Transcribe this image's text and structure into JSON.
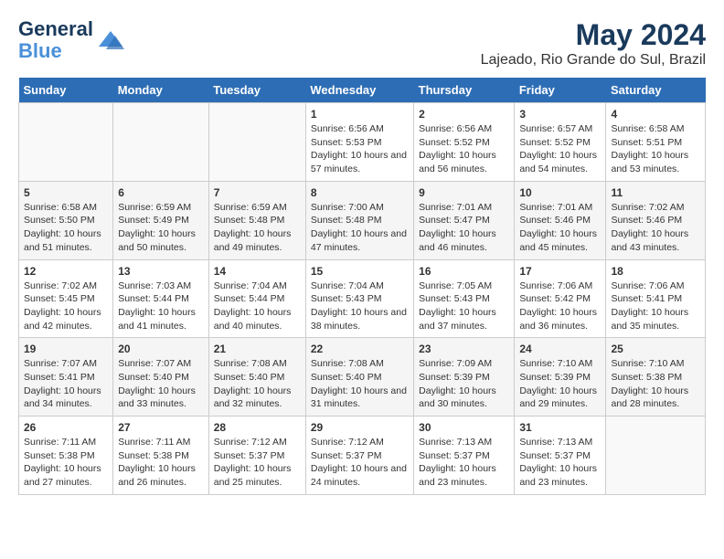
{
  "logo": {
    "line1": "General",
    "line2": "Blue"
  },
  "title": "May 2024",
  "subtitle": "Lajeado, Rio Grande do Sul, Brazil",
  "days_header": [
    "Sunday",
    "Monday",
    "Tuesday",
    "Wednesday",
    "Thursday",
    "Friday",
    "Saturday"
  ],
  "weeks": [
    [
      {
        "day": "",
        "sunrise": "",
        "sunset": "",
        "daylight": ""
      },
      {
        "day": "",
        "sunrise": "",
        "sunset": "",
        "daylight": ""
      },
      {
        "day": "",
        "sunrise": "",
        "sunset": "",
        "daylight": ""
      },
      {
        "day": "1",
        "sunrise": "Sunrise: 6:56 AM",
        "sunset": "Sunset: 5:53 PM",
        "daylight": "Daylight: 10 hours and 57 minutes."
      },
      {
        "day": "2",
        "sunrise": "Sunrise: 6:56 AM",
        "sunset": "Sunset: 5:52 PM",
        "daylight": "Daylight: 10 hours and 56 minutes."
      },
      {
        "day": "3",
        "sunrise": "Sunrise: 6:57 AM",
        "sunset": "Sunset: 5:52 PM",
        "daylight": "Daylight: 10 hours and 54 minutes."
      },
      {
        "day": "4",
        "sunrise": "Sunrise: 6:58 AM",
        "sunset": "Sunset: 5:51 PM",
        "daylight": "Daylight: 10 hours and 53 minutes."
      }
    ],
    [
      {
        "day": "5",
        "sunrise": "Sunrise: 6:58 AM",
        "sunset": "Sunset: 5:50 PM",
        "daylight": "Daylight: 10 hours and 51 minutes."
      },
      {
        "day": "6",
        "sunrise": "Sunrise: 6:59 AM",
        "sunset": "Sunset: 5:49 PM",
        "daylight": "Daylight: 10 hours and 50 minutes."
      },
      {
        "day": "7",
        "sunrise": "Sunrise: 6:59 AM",
        "sunset": "Sunset: 5:48 PM",
        "daylight": "Daylight: 10 hours and 49 minutes."
      },
      {
        "day": "8",
        "sunrise": "Sunrise: 7:00 AM",
        "sunset": "Sunset: 5:48 PM",
        "daylight": "Daylight: 10 hours and 47 minutes."
      },
      {
        "day": "9",
        "sunrise": "Sunrise: 7:01 AM",
        "sunset": "Sunset: 5:47 PM",
        "daylight": "Daylight: 10 hours and 46 minutes."
      },
      {
        "day": "10",
        "sunrise": "Sunrise: 7:01 AM",
        "sunset": "Sunset: 5:46 PM",
        "daylight": "Daylight: 10 hours and 45 minutes."
      },
      {
        "day": "11",
        "sunrise": "Sunrise: 7:02 AM",
        "sunset": "Sunset: 5:46 PM",
        "daylight": "Daylight: 10 hours and 43 minutes."
      }
    ],
    [
      {
        "day": "12",
        "sunrise": "Sunrise: 7:02 AM",
        "sunset": "Sunset: 5:45 PM",
        "daylight": "Daylight: 10 hours and 42 minutes."
      },
      {
        "day": "13",
        "sunrise": "Sunrise: 7:03 AM",
        "sunset": "Sunset: 5:44 PM",
        "daylight": "Daylight: 10 hours and 41 minutes."
      },
      {
        "day": "14",
        "sunrise": "Sunrise: 7:04 AM",
        "sunset": "Sunset: 5:44 PM",
        "daylight": "Daylight: 10 hours and 40 minutes."
      },
      {
        "day": "15",
        "sunrise": "Sunrise: 7:04 AM",
        "sunset": "Sunset: 5:43 PM",
        "daylight": "Daylight: 10 hours and 38 minutes."
      },
      {
        "day": "16",
        "sunrise": "Sunrise: 7:05 AM",
        "sunset": "Sunset: 5:43 PM",
        "daylight": "Daylight: 10 hours and 37 minutes."
      },
      {
        "day": "17",
        "sunrise": "Sunrise: 7:06 AM",
        "sunset": "Sunset: 5:42 PM",
        "daylight": "Daylight: 10 hours and 36 minutes."
      },
      {
        "day": "18",
        "sunrise": "Sunrise: 7:06 AM",
        "sunset": "Sunset: 5:41 PM",
        "daylight": "Daylight: 10 hours and 35 minutes."
      }
    ],
    [
      {
        "day": "19",
        "sunrise": "Sunrise: 7:07 AM",
        "sunset": "Sunset: 5:41 PM",
        "daylight": "Daylight: 10 hours and 34 minutes."
      },
      {
        "day": "20",
        "sunrise": "Sunrise: 7:07 AM",
        "sunset": "Sunset: 5:40 PM",
        "daylight": "Daylight: 10 hours and 33 minutes."
      },
      {
        "day": "21",
        "sunrise": "Sunrise: 7:08 AM",
        "sunset": "Sunset: 5:40 PM",
        "daylight": "Daylight: 10 hours and 32 minutes."
      },
      {
        "day": "22",
        "sunrise": "Sunrise: 7:08 AM",
        "sunset": "Sunset: 5:40 PM",
        "daylight": "Daylight: 10 hours and 31 minutes."
      },
      {
        "day": "23",
        "sunrise": "Sunrise: 7:09 AM",
        "sunset": "Sunset: 5:39 PM",
        "daylight": "Daylight: 10 hours and 30 minutes."
      },
      {
        "day": "24",
        "sunrise": "Sunrise: 7:10 AM",
        "sunset": "Sunset: 5:39 PM",
        "daylight": "Daylight: 10 hours and 29 minutes."
      },
      {
        "day": "25",
        "sunrise": "Sunrise: 7:10 AM",
        "sunset": "Sunset: 5:38 PM",
        "daylight": "Daylight: 10 hours and 28 minutes."
      }
    ],
    [
      {
        "day": "26",
        "sunrise": "Sunrise: 7:11 AM",
        "sunset": "Sunset: 5:38 PM",
        "daylight": "Daylight: 10 hours and 27 minutes."
      },
      {
        "day": "27",
        "sunrise": "Sunrise: 7:11 AM",
        "sunset": "Sunset: 5:38 PM",
        "daylight": "Daylight: 10 hours and 26 minutes."
      },
      {
        "day": "28",
        "sunrise": "Sunrise: 7:12 AM",
        "sunset": "Sunset: 5:37 PM",
        "daylight": "Daylight: 10 hours and 25 minutes."
      },
      {
        "day": "29",
        "sunrise": "Sunrise: 7:12 AM",
        "sunset": "Sunset: 5:37 PM",
        "daylight": "Daylight: 10 hours and 24 minutes."
      },
      {
        "day": "30",
        "sunrise": "Sunrise: 7:13 AM",
        "sunset": "Sunset: 5:37 PM",
        "daylight": "Daylight: 10 hours and 23 minutes."
      },
      {
        "day": "31",
        "sunrise": "Sunrise: 7:13 AM",
        "sunset": "Sunset: 5:37 PM",
        "daylight": "Daylight: 10 hours and 23 minutes."
      },
      {
        "day": "",
        "sunrise": "",
        "sunset": "",
        "daylight": ""
      }
    ]
  ]
}
